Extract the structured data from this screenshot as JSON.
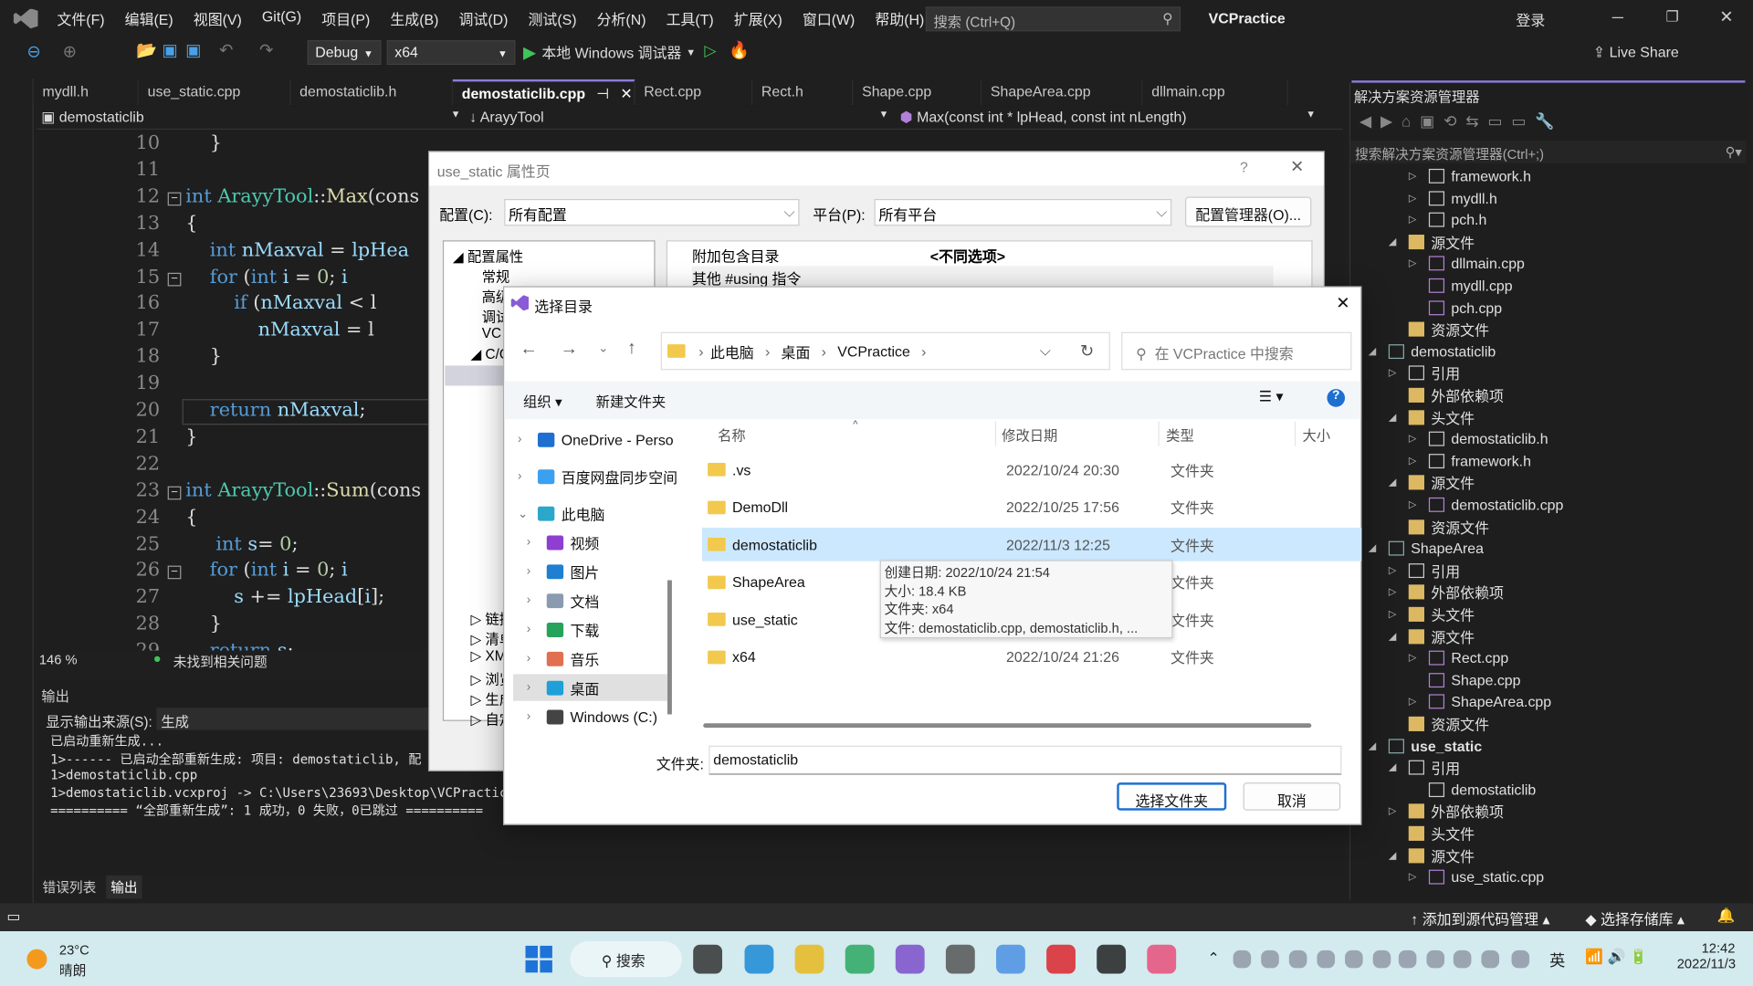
{
  "app": {
    "title": "VCPractice",
    "menu": [
      "文件(F)",
      "编辑(E)",
      "视图(V)",
      "Git(G)",
      "项目(P)",
      "生成(B)",
      "调试(D)",
      "测试(S)",
      "分析(N)",
      "工具(T)",
      "扩展(X)",
      "窗口(W)",
      "帮助(H)"
    ],
    "search_placeholder": "搜索 (Ctrl+Q)",
    "login": "登录",
    "live_share": "Live Share"
  },
  "toolbar": {
    "config": "Debug",
    "platform": "x64",
    "run_label": "本地 Windows 调试器"
  },
  "tabs": [
    "mydll.h",
    "use_static.cpp",
    "demostaticlib.h",
    "demostaticlib.cpp",
    "Rect.cpp",
    "Rect.h",
    "Shape.cpp",
    "ShapeArea.cpp",
    "dllmain.cpp"
  ],
  "active_tab": "demostaticlib.cpp",
  "navbar": {
    "project": "demostaticlib",
    "scope": "ArayyTool",
    "member": "Max(const int * lpHead, const int nLength)"
  },
  "editor": {
    "lines": [
      {
        "n": "10",
        "t": "    }"
      },
      {
        "n": "11",
        "t": ""
      },
      {
        "n": "12",
        "t": "int ArayyTool::Max(cons"
      },
      {
        "n": "13",
        "t": "{"
      },
      {
        "n": "14",
        "t": "    int nMaxval = lpHea"
      },
      {
        "n": "15",
        "t": "    for (int i = 0; i "
      },
      {
        "n": "16",
        "t": "        if (nMaxval < l"
      },
      {
        "n": "17",
        "t": "            nMaxval = l"
      },
      {
        "n": "18",
        "t": "    }"
      },
      {
        "n": "19",
        "t": ""
      },
      {
        "n": "20",
        "t": "    return nMaxval;"
      },
      {
        "n": "21",
        "t": "}"
      },
      {
        "n": "22",
        "t": ""
      },
      {
        "n": "23",
        "t": "int ArayyTool::Sum(cons"
      },
      {
        "n": "24",
        "t": "{"
      },
      {
        "n": "25",
        "t": "     int s= 0;"
      },
      {
        "n": "26",
        "t": "    for (int i = 0; i "
      },
      {
        "n": "27",
        "t": "        s += lpHead[i];"
      },
      {
        "n": "28",
        "t": "    }"
      },
      {
        "n": "29",
        "t": "    return s;"
      }
    ],
    "zoom": "146 %",
    "issues": "未找到相关问题"
  },
  "output": {
    "title": "输出",
    "source_label": "显示输出来源(S):",
    "source_value": "生成",
    "lines": [
      "已启动重新生成...",
      "1>------ 已启动全部重新生成: 项目: demostaticlib, 配",
      "1>demostaticlib.cpp",
      "1>demostaticlib.vcxproj -> C:\\Users\\23693\\Desktop\\VCPractice\\x",
      "========== “全部重新生成”: 1 成功，0 失败，0已跳过 =========="
    ]
  },
  "bottom_tabs": [
    "错误列表",
    "输出"
  ],
  "statusbar": {
    "source_control": "添加到源代码管理",
    "repo": "选择存储库"
  },
  "solution_explorer": {
    "title": "解决方案资源管理器",
    "search_placeholder": "搜索解决方案资源管理器(Ctrl+;)",
    "items": [
      {
        "l": "framework.h",
        "lv": 3,
        "i": "file",
        "e": ">"
      },
      {
        "l": "mydll.h",
        "lv": 3,
        "i": "file",
        "e": ">"
      },
      {
        "l": "pch.h",
        "lv": 3,
        "i": "file",
        "e": ">"
      },
      {
        "l": "源文件",
        "lv": 2,
        "i": "folder",
        "e": "v"
      },
      {
        "l": "dllmain.cpp",
        "lv": 3,
        "i": "cpp",
        "e": ">"
      },
      {
        "l": "mydll.cpp",
        "lv": 3,
        "i": "cpp",
        "e": ""
      },
      {
        "l": "pch.cpp",
        "lv": 3,
        "i": "cpp",
        "e": ""
      },
      {
        "l": "资源文件",
        "lv": 2,
        "i": "folder",
        "e": ""
      },
      {
        "l": "demostaticlib",
        "lv": 1,
        "i": "proj",
        "e": "v"
      },
      {
        "l": "引用",
        "lv": 2,
        "i": "ref",
        "e": ">"
      },
      {
        "l": "外部依赖项",
        "lv": 2,
        "i": "folder",
        "e": ""
      },
      {
        "l": "头文件",
        "lv": 2,
        "i": "folder",
        "e": "v"
      },
      {
        "l": "demostaticlib.h",
        "lv": 3,
        "i": "file",
        "e": ">"
      },
      {
        "l": "framework.h",
        "lv": 3,
        "i": "file",
        "e": ">"
      },
      {
        "l": "源文件",
        "lv": 2,
        "i": "folder",
        "e": "v"
      },
      {
        "l": "demostaticlib.cpp",
        "lv": 3,
        "i": "cpp",
        "e": ">"
      },
      {
        "l": "资源文件",
        "lv": 2,
        "i": "folder",
        "e": ""
      },
      {
        "l": "ShapeArea",
        "lv": 1,
        "i": "proj",
        "e": "v"
      },
      {
        "l": "引用",
        "lv": 2,
        "i": "ref",
        "e": ">"
      },
      {
        "l": "外部依赖项",
        "lv": 2,
        "i": "folder",
        "e": ">"
      },
      {
        "l": "头文件",
        "lv": 2,
        "i": "folder",
        "e": ">"
      },
      {
        "l": "源文件",
        "lv": 2,
        "i": "folder",
        "e": "v"
      },
      {
        "l": "Rect.cpp",
        "lv": 3,
        "i": "cpp",
        "e": ">"
      },
      {
        "l": "Shape.cpp",
        "lv": 3,
        "i": "cpp",
        "e": ""
      },
      {
        "l": "ShapeArea.cpp",
        "lv": 3,
        "i": "cpp",
        "e": ">"
      },
      {
        "l": "资源文件",
        "lv": 2,
        "i": "folder",
        "e": ""
      },
      {
        "l": "use_static",
        "lv": 1,
        "i": "proj",
        "e": "v",
        "b": true
      },
      {
        "l": "引用",
        "lv": 2,
        "i": "ref",
        "e": "v"
      },
      {
        "l": "demostaticlib",
        "lv": 3,
        "i": "ref",
        "e": ""
      },
      {
        "l": "外部依赖项",
        "lv": 2,
        "i": "folder",
        "e": ">"
      },
      {
        "l": "头文件",
        "lv": 2,
        "i": "folder",
        "e": ""
      },
      {
        "l": "源文件",
        "lv": 2,
        "i": "folder",
        "e": "v"
      },
      {
        "l": "use_static.cpp",
        "lv": 3,
        "i": "cpp",
        "e": ">"
      }
    ]
  },
  "property_dialog": {
    "title": "use_static 属性页",
    "config_label": "配置(C):",
    "config_value": "所有配置",
    "platform_label": "平台(P):",
    "platform_value": "所有平台",
    "config_manager": "配置管理器(O)...",
    "tree": [
      "配置属性",
      "常规",
      "高级",
      "调试",
      "VC",
      "C/C",
      "链接",
      "清单",
      "XML",
      "浏览",
      "生成",
      "自定"
    ],
    "props": [
      {
        "name": "附加包含目录",
        "value": "<不同选项>"
      },
      {
        "name": "其他 #using 指令",
        "value": ""
      }
    ]
  },
  "folder_dialog": {
    "title": "选择目录",
    "breadcrumb": [
      "此电脑",
      "桌面",
      "VCPractice"
    ],
    "search_placeholder": "在 VCPractice 中搜索",
    "organize": "组织",
    "new_folder": "新建文件夹",
    "nav": [
      {
        "l": "OneDrive - Perso",
        "i": "cloud"
      },
      {
        "l": "百度网盘同步空间",
        "i": "baidu"
      },
      {
        "l": "此电脑",
        "i": "pc"
      },
      {
        "l": "视频",
        "i": "video"
      },
      {
        "l": "图片",
        "i": "pic"
      },
      {
        "l": "文档",
        "i": "doc"
      },
      {
        "l": "下载",
        "i": "down"
      },
      {
        "l": "音乐",
        "i": "music"
      },
      {
        "l": "桌面",
        "i": "desk"
      },
      {
        "l": "Windows (C:)",
        "i": "drive"
      }
    ],
    "columns": [
      "名称",
      "修改日期",
      "类型",
      "大小"
    ],
    "rows": [
      {
        "name": ".vs",
        "date": "2022/10/24 20:30",
        "type": "文件夹"
      },
      {
        "name": "DemoDll",
        "date": "2022/10/25 17:56",
        "type": "文件夹"
      },
      {
        "name": "demostaticlib",
        "date": "2022/11/3 12:25",
        "type": "文件夹",
        "selected": true
      },
      {
        "name": "ShapeArea",
        "date": "",
        "type": "文件夹"
      },
      {
        "name": "use_static",
        "date": "",
        "type": "文件夹"
      },
      {
        "name": "x64",
        "date": "2022/10/24 21:26",
        "type": "文件夹"
      }
    ],
    "tooltip": [
      "创建日期: 2022/10/24 21:54",
      "大小: 18.4 KB",
      "文件夹: x64",
      "文件: demostaticlib.cpp, demostaticlib.h, ..."
    ],
    "folder_label": "文件夹:",
    "folder_value": "demostaticlib",
    "select_button": "选择文件夹",
    "cancel_button": "取消"
  },
  "taskbar": {
    "weather_temp": "23°C",
    "weather_desc": "晴朗",
    "search": "搜索",
    "ime": "英",
    "time": "12:42",
    "date": "2022/11/3"
  }
}
